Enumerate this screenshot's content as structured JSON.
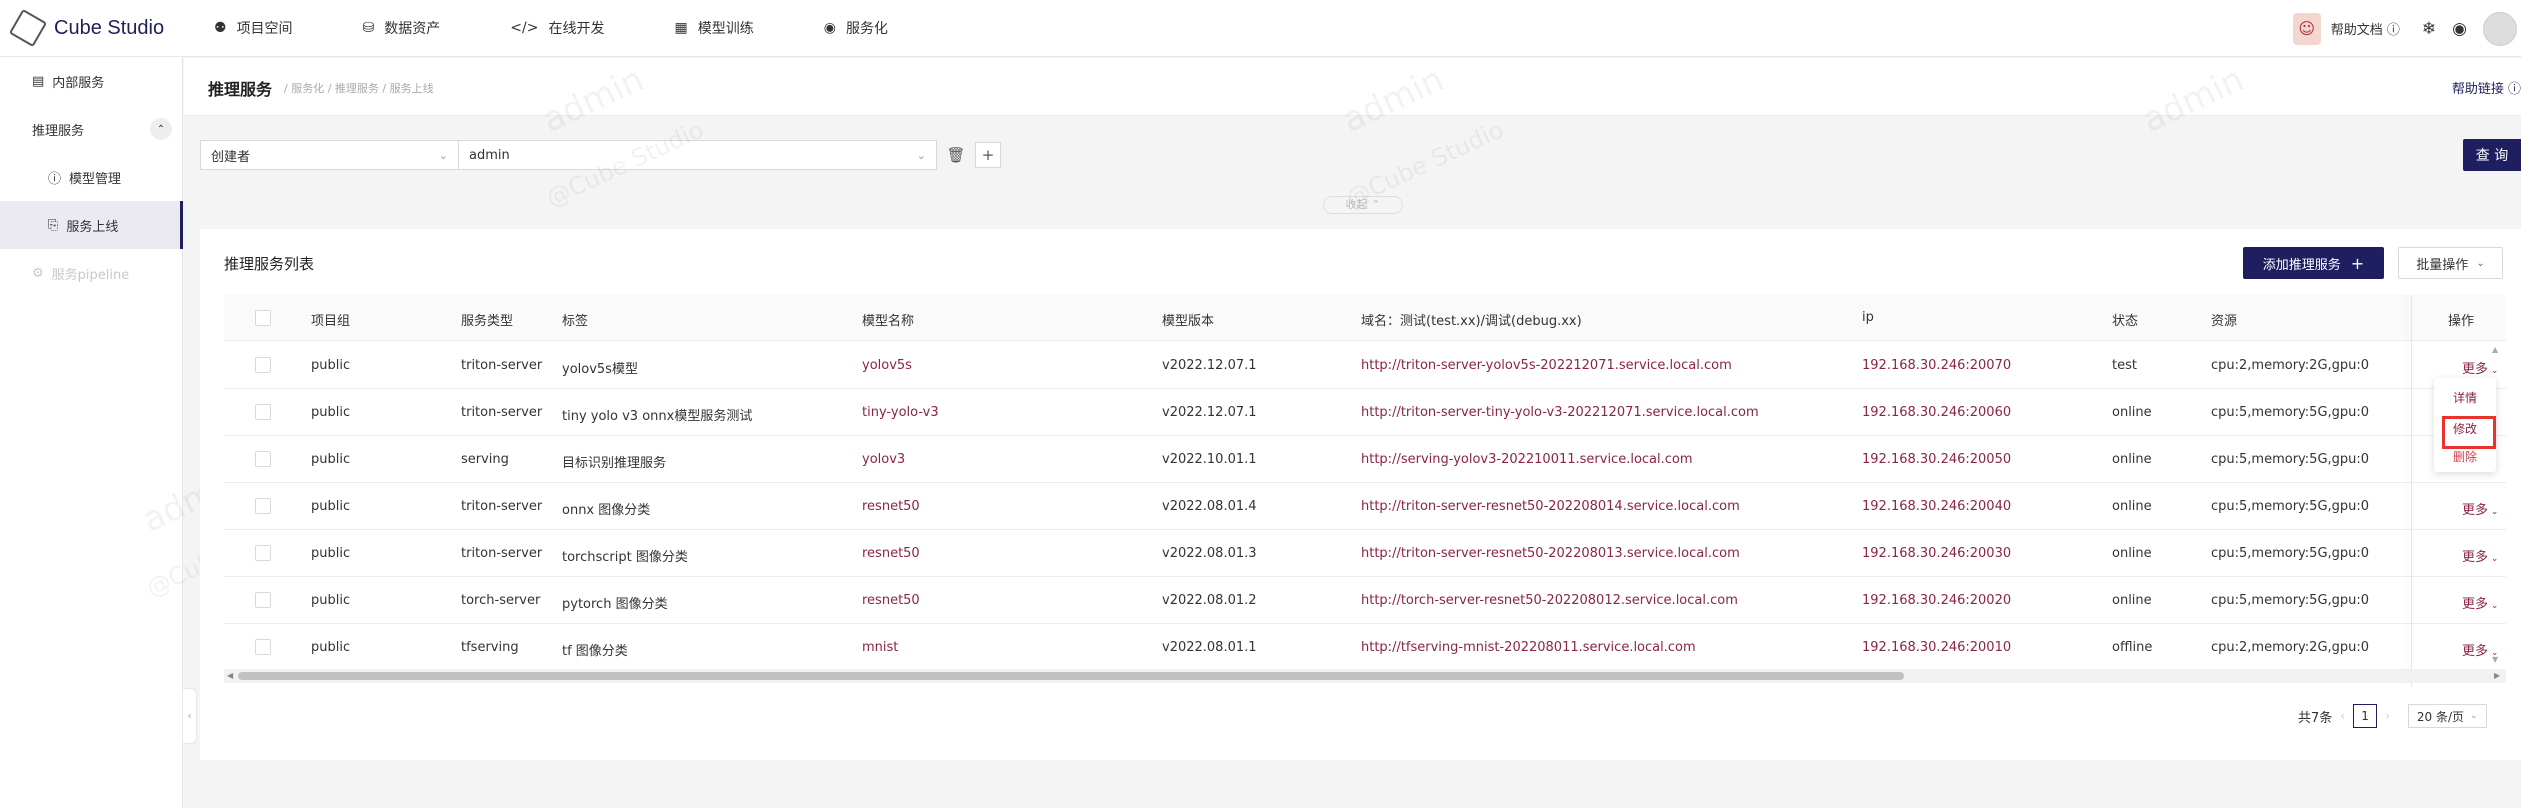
{
  "header": {
    "app_name": "Cube Studio",
    "nav": [
      {
        "label": "项目空间",
        "icon": "team-icon"
      },
      {
        "label": "数据资产",
        "icon": "database-icon"
      },
      {
        "label": "在线开发",
        "icon": "code-icon"
      },
      {
        "label": "模型训练",
        "icon": "training-icon"
      },
      {
        "label": "服务化",
        "icon": "service-icon"
      }
    ],
    "help_doc": "帮助文档"
  },
  "sidebar": {
    "items": [
      {
        "label": "内部服务",
        "icon": "book-icon"
      },
      {
        "label": "推理服务",
        "icon": ""
      },
      {
        "label": "模型管理",
        "icon": "info-icon"
      },
      {
        "label": "服务上线",
        "icon": "deploy-icon"
      },
      {
        "label": "服务pipeline",
        "icon": "pipeline-icon"
      }
    ]
  },
  "page": {
    "title": "推理服务",
    "breadcrumb": "/ 服务化 / 推理服务 / 服务上线",
    "help_link": "帮助链接"
  },
  "filter": {
    "field": "创建者",
    "value": "admin",
    "query_button": "查 询",
    "fold_toggle": "收起"
  },
  "table": {
    "title": "推理服务列表",
    "add_button": "添加推理服务",
    "batch_button": "批量操作",
    "columns": [
      "项目组",
      "服务类型",
      "标签",
      "模型名称",
      "模型版本",
      "域名：测试(test.xx)/调试(debug.xx)",
      "ip",
      "状态",
      "资源",
      "操作"
    ],
    "rows": [
      {
        "project": "public",
        "type": "triton-server",
        "label": "yolov5s模型",
        "model": "yolov5s",
        "version": "v2022.12.07.1",
        "domain": "http://triton-server-yolov5s-202212071.service.local.com",
        "ip": "192.168.30.246:20070",
        "status": "test",
        "resource": "cpu:2,memory:2G,gpu:0"
      },
      {
        "project": "public",
        "type": "triton-server",
        "label": "tiny yolo v3 onnx模型服务测试",
        "model": "tiny-yolo-v3",
        "version": "v2022.12.07.1",
        "domain": "http://triton-server-tiny-yolo-v3-202212071.service.local.com",
        "ip": "192.168.30.246:20060",
        "status": "online",
        "resource": "cpu:5,memory:5G,gpu:0"
      },
      {
        "project": "public",
        "type": "serving",
        "label": "目标识别推理服务",
        "model": "yolov3",
        "version": "v2022.10.01.1",
        "domain": "http://serving-yolov3-202210011.service.local.com",
        "ip": "192.168.30.246:20050",
        "status": "online",
        "resource": "cpu:5,memory:5G,gpu:0"
      },
      {
        "project": "public",
        "type": "triton-server",
        "label": "onnx 图像分类",
        "model": "resnet50",
        "version": "v2022.08.01.4",
        "domain": "http://triton-server-resnet50-202208014.service.local.com",
        "ip": "192.168.30.246:20040",
        "status": "online",
        "resource": "cpu:5,memory:5G,gpu:0"
      },
      {
        "project": "public",
        "type": "triton-server",
        "label": "torchscript 图像分类",
        "model": "resnet50",
        "version": "v2022.08.01.3",
        "domain": "http://triton-server-resnet50-202208013.service.local.com",
        "ip": "192.168.30.246:20030",
        "status": "online",
        "resource": "cpu:5,memory:5G,gpu:0"
      },
      {
        "project": "public",
        "type": "torch-server",
        "label": "pytorch 图像分类",
        "model": "resnet50",
        "version": "v2022.08.01.2",
        "domain": "http://torch-server-resnet50-202208012.service.local.com",
        "ip": "192.168.30.246:20020",
        "status": "online",
        "resource": "cpu:5,memory:5G,gpu:0"
      },
      {
        "project": "public",
        "type": "tfserving",
        "label": "tf 图像分类",
        "model": "mnist",
        "version": "v2022.08.01.1",
        "domain": "http://tfserving-mnist-202208011.service.local.com",
        "ip": "192.168.30.246:20010",
        "status": "offline",
        "resource": "cpu:2,memory:2G,gpu:0"
      }
    ],
    "more_label": "更多",
    "dropdown": [
      "详情",
      "修改",
      "删除"
    ]
  },
  "pagination": {
    "total": "共7条",
    "current": "1",
    "page_size": "20 条/页"
  },
  "watermark": {
    "user": "admin",
    "brand": "@Cube Studio"
  }
}
